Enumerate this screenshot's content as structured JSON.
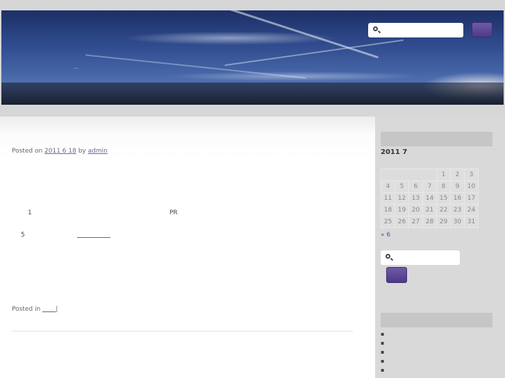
{
  "header": {
    "dots": "..."
  },
  "post": {
    "meta_prefix": "Posted on",
    "date": "2011 6 18",
    "by": "by",
    "author": "admin",
    "line1_num": "1",
    "line1_tail": "PR",
    "line2_num": "5",
    "footer_prefix": "Posted in",
    "footer_link": "_ _ _|"
  },
  "calendar": {
    "caption": "2011  7",
    "rows": [
      [
        "",
        "",
        "",
        "",
        "1",
        "2",
        "3"
      ],
      [
        "4",
        "5",
        "6",
        "7",
        "8",
        "9",
        "10"
      ],
      [
        "11",
        "12",
        "13",
        "14",
        "15",
        "16",
        "17"
      ],
      [
        "18",
        "19",
        "20",
        "21",
        "22",
        "23",
        "24"
      ],
      [
        "25",
        "26",
        "27",
        "28",
        "29",
        "30",
        "31"
      ]
    ],
    "prev": "« 6"
  },
  "sidebar_list": [
    "▪",
    "▪",
    "▪",
    "▪",
    "▪"
  ],
  "colors": {
    "button": "#5b4796",
    "link": "#2c5fa8"
  }
}
